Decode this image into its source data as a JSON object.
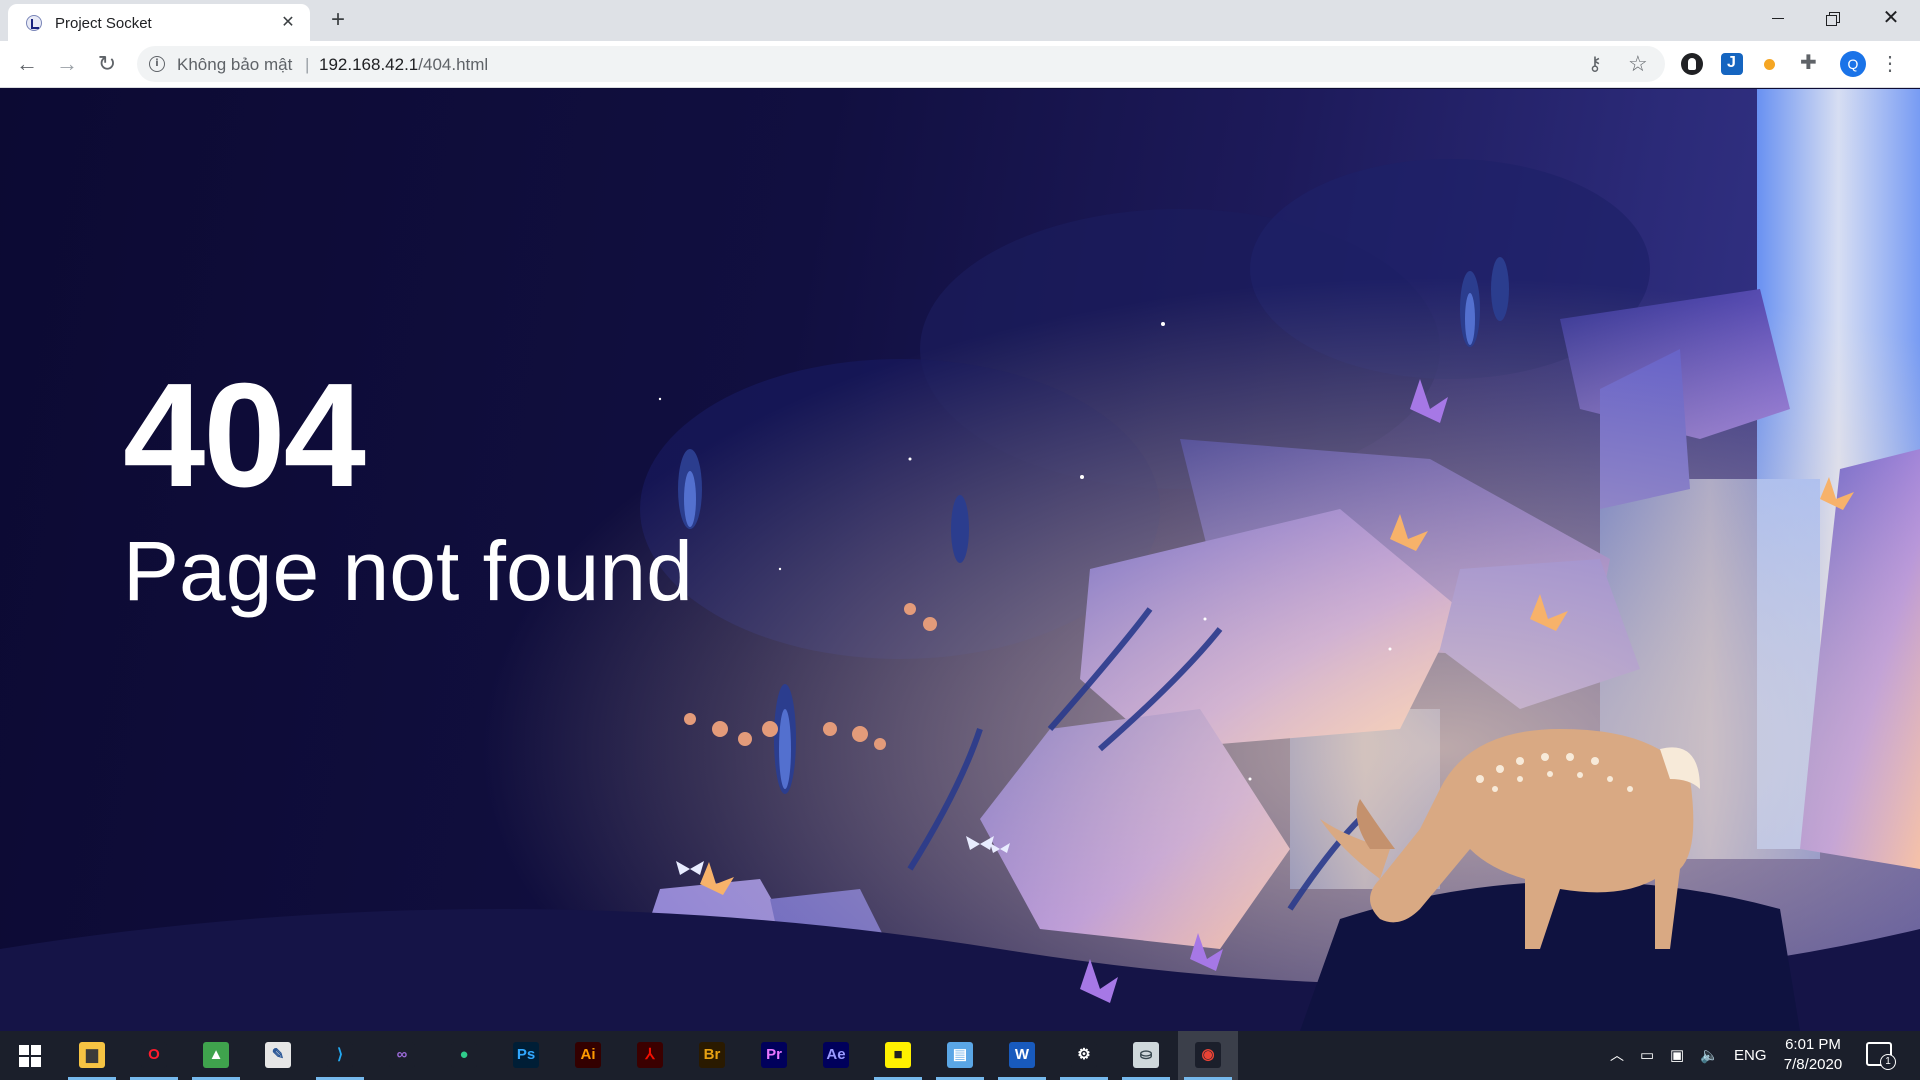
{
  "browser": {
    "tab_title": "Project Socket",
    "tab_close": "✕",
    "new_tab": "+",
    "security_label": "Không bảo mật",
    "url_host": "192.168.42.1",
    "url_path": "/404.html",
    "profile_initial": "Q"
  },
  "page": {
    "error_code": "404",
    "error_message": "Page not found"
  },
  "taskbar": {
    "apps": [
      {
        "name": "file-explorer",
        "glyph": "▆",
        "color": "#f6c343",
        "fg": "#3a3a3a",
        "running": true
      },
      {
        "name": "opera",
        "glyph": "O",
        "color": "#1b1f2b",
        "fg": "#ff1b2d",
        "running": true
      },
      {
        "name": "photos-app",
        "glyph": "▲",
        "color": "#3fa34d",
        "fg": "#ffffff",
        "running": true
      },
      {
        "name": "notepad-app",
        "glyph": "✎",
        "color": "#e6e6e6",
        "fg": "#2b5797",
        "running": false
      },
      {
        "name": "vscode",
        "glyph": "⟩",
        "color": "#1b1f2b",
        "fg": "#23a9f2",
        "running": true
      },
      {
        "name": "visual-studio",
        "glyph": "∞",
        "color": "#1b1f2b",
        "fg": "#9b6ad8",
        "running": false
      },
      {
        "name": "gitkraken",
        "glyph": "●",
        "color": "#1b1f2b",
        "fg": "#2fcc8b",
        "running": false
      },
      {
        "name": "photoshop",
        "glyph": "Ps",
        "color": "#001e36",
        "fg": "#31a8ff",
        "running": false
      },
      {
        "name": "illustrator",
        "glyph": "Ai",
        "color": "#330000",
        "fg": "#ff9a00",
        "running": false
      },
      {
        "name": "acrobat",
        "glyph": "⅄",
        "color": "#3b0000",
        "fg": "#f40f02",
        "running": false
      },
      {
        "name": "bridge",
        "glyph": "Br",
        "color": "#2a1a00",
        "fg": "#e7a112",
        "running": false
      },
      {
        "name": "premiere",
        "glyph": "Pr",
        "color": "#00005b",
        "fg": "#ea77ff",
        "running": false
      },
      {
        "name": "after-effects",
        "glyph": "Ae",
        "color": "#00005b",
        "fg": "#9999ff",
        "running": false
      },
      {
        "name": "sticky-notes",
        "glyph": "■",
        "color": "#fff100",
        "fg": "#222222",
        "running": true
      },
      {
        "name": "control-panel",
        "glyph": "▤",
        "color": "#5aa6e6",
        "fg": "#ffffff",
        "running": true
      },
      {
        "name": "word",
        "glyph": "W",
        "color": "#185abd",
        "fg": "#ffffff",
        "running": true
      },
      {
        "name": "settings",
        "glyph": "⚙",
        "color": "#1b1f2b",
        "fg": "#ffffff",
        "running": true
      },
      {
        "name": "network-tool",
        "glyph": "⛀",
        "color": "#cfd8dc",
        "fg": "#37474f",
        "running": true
      },
      {
        "name": "chrome",
        "glyph": "◉",
        "color": "#1b1f2b",
        "fg": "#ea4335",
        "running": true,
        "active": true
      }
    ],
    "language": "ENG",
    "time": "6:01 PM",
    "date": "7/8/2020",
    "notification_count": "1"
  }
}
